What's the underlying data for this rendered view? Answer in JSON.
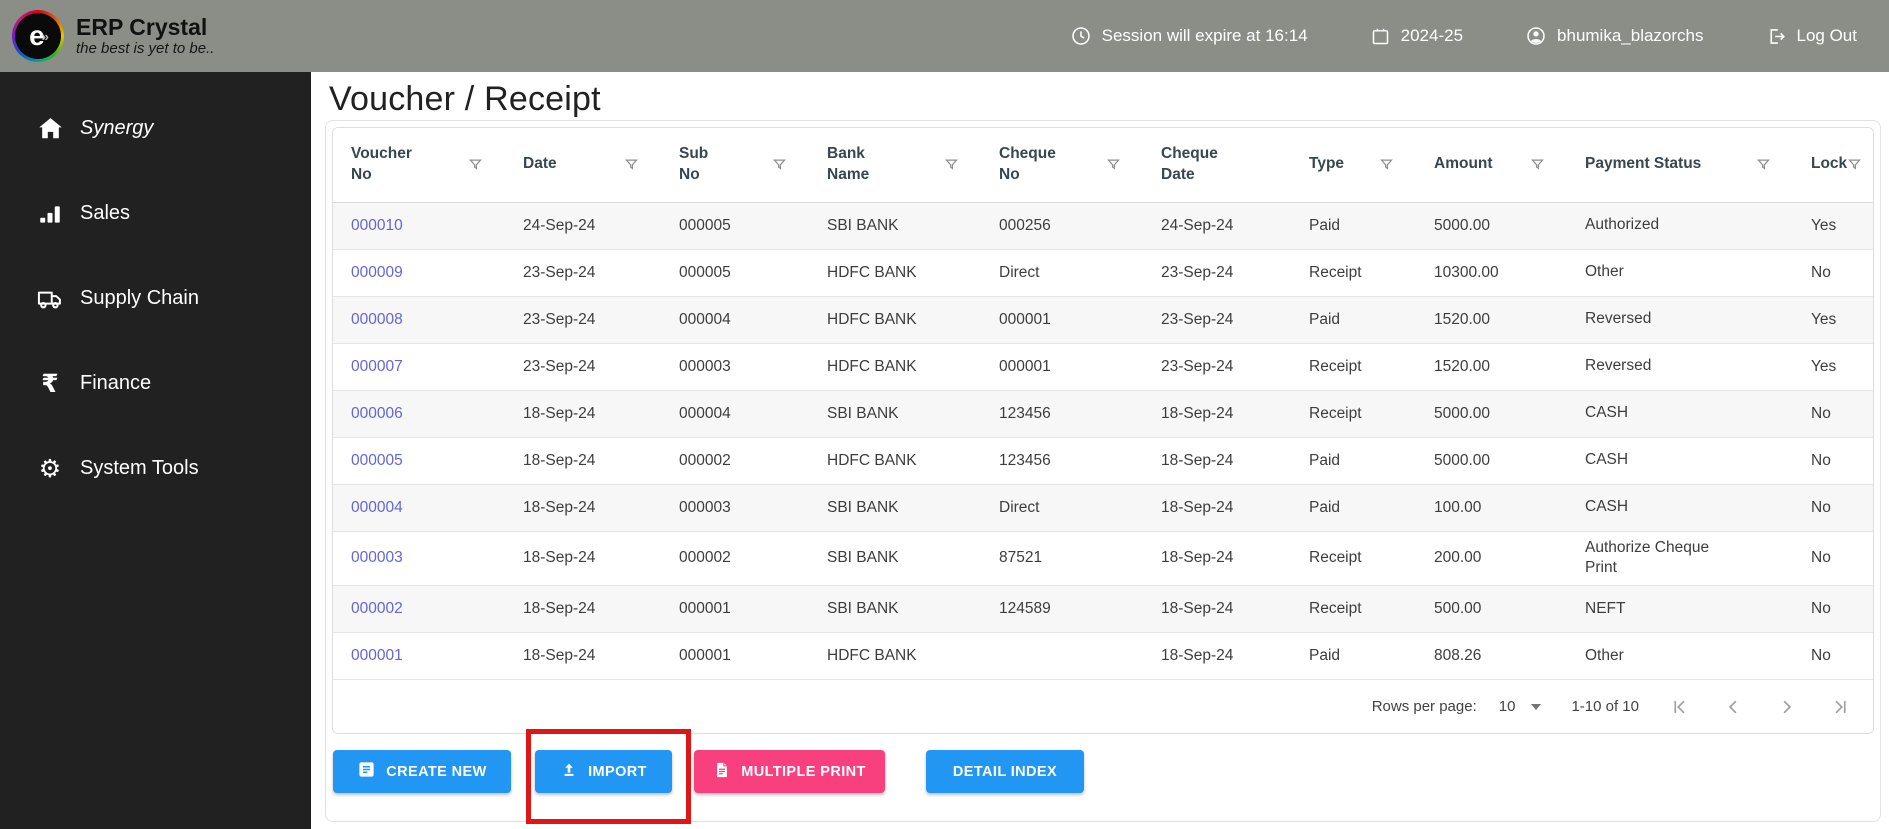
{
  "header": {
    "app_name": "ERP Crystal",
    "tagline": "the best is yet to be..",
    "session_text": "Session will expire at 16:14",
    "fiscal_year": "2024-25",
    "username": "bhumika_blazorchs",
    "logout_label": "Log Out",
    "logo_letter": "e"
  },
  "sidebar": {
    "items": [
      {
        "label": "Synergy"
      },
      {
        "label": "Sales"
      },
      {
        "label": "Supply Chain"
      },
      {
        "label": "Finance"
      },
      {
        "label": "System Tools"
      }
    ]
  },
  "page": {
    "title": "Voucher / Receipt"
  },
  "table": {
    "columns": [
      {
        "label": "Voucher\nNo",
        "filter": true
      },
      {
        "label": "Date",
        "filter": true
      },
      {
        "label": "Sub\nNo",
        "filter": true
      },
      {
        "label": "Bank\nName",
        "filter": true
      },
      {
        "label": "Cheque\nNo",
        "filter": true
      },
      {
        "label": "Cheque\nDate",
        "filter": false
      },
      {
        "label": "Type",
        "filter": true
      },
      {
        "label": "Amount",
        "filter": true
      },
      {
        "label": "Payment Status",
        "filter": true
      },
      {
        "label": "Lock",
        "filter": true
      }
    ],
    "rows": [
      [
        "000010",
        "24-Sep-24",
        "000005",
        "SBI BANK",
        "000256",
        "24-Sep-24",
        "Paid",
        "5000.00",
        "Authorized",
        "Yes"
      ],
      [
        "000009",
        "23-Sep-24",
        "000005",
        "HDFC BANK",
        "Direct",
        "23-Sep-24",
        "Receipt",
        "10300.00",
        "Other",
        "No"
      ],
      [
        "000008",
        "23-Sep-24",
        "000004",
        "HDFC BANK",
        "000001",
        "23-Sep-24",
        "Paid",
        "1520.00",
        "Reversed",
        "Yes"
      ],
      [
        "000007",
        "23-Sep-24",
        "000003",
        "HDFC BANK",
        "000001",
        "23-Sep-24",
        "Receipt",
        "1520.00",
        "Reversed",
        "Yes"
      ],
      [
        "000006",
        "18-Sep-24",
        "000004",
        "SBI BANK",
        "123456",
        "18-Sep-24",
        "Receipt",
        "5000.00",
        "CASH",
        "No"
      ],
      [
        "000005",
        "18-Sep-24",
        "000002",
        "HDFC BANK",
        "123456",
        "18-Sep-24",
        "Paid",
        "5000.00",
        "CASH",
        "No"
      ],
      [
        "000004",
        "18-Sep-24",
        "000003",
        "SBI BANK",
        "Direct",
        "18-Sep-24",
        "Paid",
        "100.00",
        "CASH",
        "No"
      ],
      [
        "000003",
        "18-Sep-24",
        "000002",
        "SBI BANK",
        "87521",
        "18-Sep-24",
        "Receipt",
        "200.00",
        "Authorize Cheque Print",
        "No"
      ],
      [
        "000002",
        "18-Sep-24",
        "000001",
        "SBI BANK",
        "124589",
        "18-Sep-24",
        "Receipt",
        "500.00",
        "NEFT",
        "No"
      ],
      [
        "000001",
        "18-Sep-24",
        "000001",
        "HDFC BANK",
        "",
        "18-Sep-24",
        "Paid",
        "808.26",
        "Other",
        "No"
      ]
    ]
  },
  "pagination": {
    "rows_per_page_label": "Rows per page:",
    "rows_per_page_value": "10",
    "range_label": "1-10 of 10"
  },
  "actions": {
    "create_new": "CREATE NEW",
    "import": "IMPORT",
    "multiple_print": "MULTIPLE PRINT",
    "detail_index": "DETAIL INDEX"
  },
  "colors": {
    "header_bg": "#8b8e86",
    "sidebar_bg": "#212121",
    "primary_blue": "#2196f3",
    "accent_pink": "#f8407f",
    "annotation_red": "#e01515",
    "voucher_link": "#6464d9"
  }
}
